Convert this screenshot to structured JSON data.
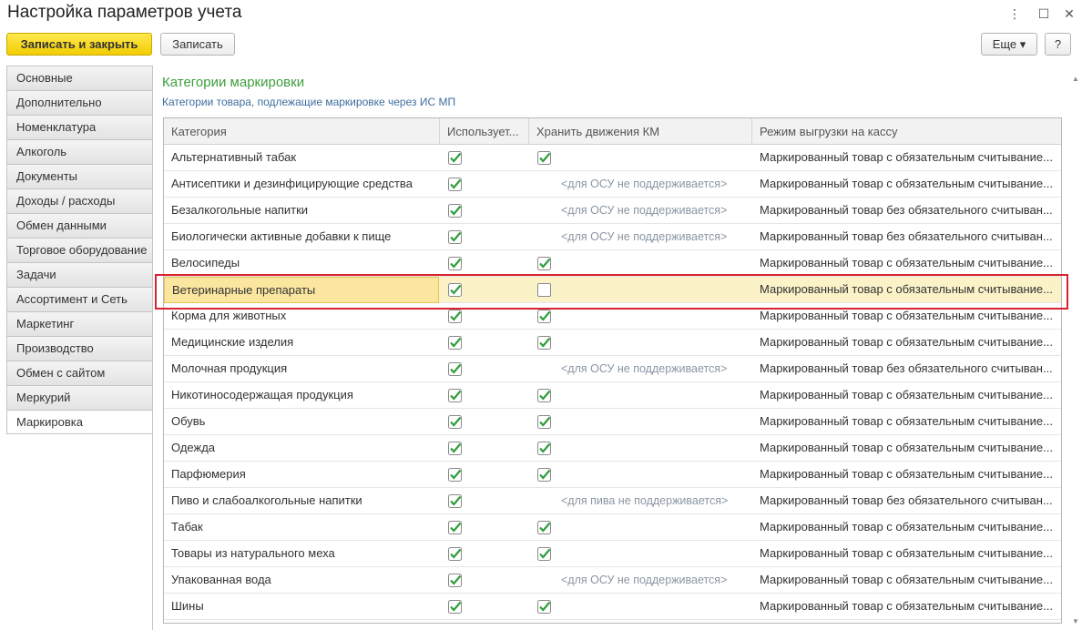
{
  "window": {
    "title": "Настройка параметров учета",
    "menu_glyph": "⋮",
    "maximize_glyph": "☐",
    "close_glyph": "✕"
  },
  "toolbar": {
    "save_close_label": "Записать и закрыть",
    "save_label": "Записать",
    "more_label": "Еще ▾",
    "help_label": "?"
  },
  "sidebar": {
    "items": [
      {
        "label": "Основные"
      },
      {
        "label": "Дополнительно"
      },
      {
        "label": "Номенклатура"
      },
      {
        "label": "Алкоголь"
      },
      {
        "label": "Документы"
      },
      {
        "label": "Доходы / расходы"
      },
      {
        "label": "Обмен данными"
      },
      {
        "label": "Торговое оборудование"
      },
      {
        "label": "Задачи"
      },
      {
        "label": "Ассортимент и Сеть"
      },
      {
        "label": "Маркетинг"
      },
      {
        "label": "Производство"
      },
      {
        "label": "Обмен с сайтом"
      },
      {
        "label": "Меркурий"
      },
      {
        "label": "Маркировка",
        "active": true
      }
    ]
  },
  "section": {
    "title": "Категории маркировки",
    "subtitle": "Категории товара, подлежащие маркировке через ИС МП"
  },
  "table": {
    "headers": [
      "Категория",
      "Использует...",
      "Хранить движения КМ",
      "Режим выгрузки на кассу"
    ],
    "rows": [
      {
        "category": "Альтернативный табак",
        "uses": true,
        "store": "check",
        "mode": "Маркированный товар с обязательным считывание..."
      },
      {
        "category": "Антисептики и дезинфицирующие средства",
        "uses": true,
        "store": "text",
        "store_text": "<для ОСУ не поддерживается>",
        "mode": "Маркированный товар с обязательным считывание..."
      },
      {
        "category": "Безалкогольные напитки",
        "uses": true,
        "store": "text",
        "store_text": "<для ОСУ не поддерживается>",
        "mode": "Маркированный товар без обязательного считыван..."
      },
      {
        "category": "Биологически активные добавки к пище",
        "uses": true,
        "store": "text",
        "store_text": "<для ОСУ не поддерживается>",
        "mode": "Маркированный товар без обязательного считыван..."
      },
      {
        "category": "Велосипеды",
        "uses": true,
        "store": "check",
        "mode": "Маркированный товар с обязательным считывание..."
      },
      {
        "category": "Ветеринарные препараты",
        "uses": true,
        "store": "empty",
        "mode": "Маркированный товар с обязательным считывание...",
        "selected": true
      },
      {
        "category": "Корма для животных",
        "uses": true,
        "store": "check",
        "mode": "Маркированный товар с обязательным считывание..."
      },
      {
        "category": "Медицинские изделия",
        "uses": true,
        "store": "check",
        "mode": "Маркированный товар с обязательным считывание..."
      },
      {
        "category": "Молочная продукция",
        "uses": true,
        "store": "text",
        "store_text": "<для ОСУ не поддерживается>",
        "mode": "Маркированный товар без обязательного считыван..."
      },
      {
        "category": "Никотиносодержащая продукция",
        "uses": true,
        "store": "check",
        "mode": "Маркированный товар с обязательным считывание..."
      },
      {
        "category": "Обувь",
        "uses": true,
        "store": "check",
        "mode": "Маркированный товар с обязательным считывание..."
      },
      {
        "category": "Одежда",
        "uses": true,
        "store": "check",
        "mode": "Маркированный товар с обязательным считывание..."
      },
      {
        "category": "Парфюмерия",
        "uses": true,
        "store": "check",
        "mode": "Маркированный товар с обязательным считывание..."
      },
      {
        "category": "Пиво и слабоалкогольные напитки",
        "uses": true,
        "store": "text",
        "store_text": "<для пива не поддерживается>",
        "mode": "Маркированный товар без обязательного считыван..."
      },
      {
        "category": "Табак",
        "uses": true,
        "store": "check",
        "mode": "Маркированный товар с обязательным считывание..."
      },
      {
        "category": "Товары из натурального меха",
        "uses": true,
        "store": "check",
        "mode": "Маркированный товар с обязательным считывание..."
      },
      {
        "category": "Упакованная вода",
        "uses": true,
        "store": "text",
        "store_text": "<для ОСУ не поддерживается>",
        "mode": "Маркированный товар с обязательным считывание..."
      },
      {
        "category": "Шины",
        "uses": true,
        "store": "check",
        "mode": "Маркированный товар с обязательным считывание..."
      }
    ]
  },
  "colors": {
    "accent_green": "#3d9f3d",
    "link_blue": "#3d6e9e",
    "check_green": "#2e9e3a",
    "selection": "#fbf2c8",
    "highlight_red": "#d9232e",
    "primary_button": "#f2cd00"
  }
}
